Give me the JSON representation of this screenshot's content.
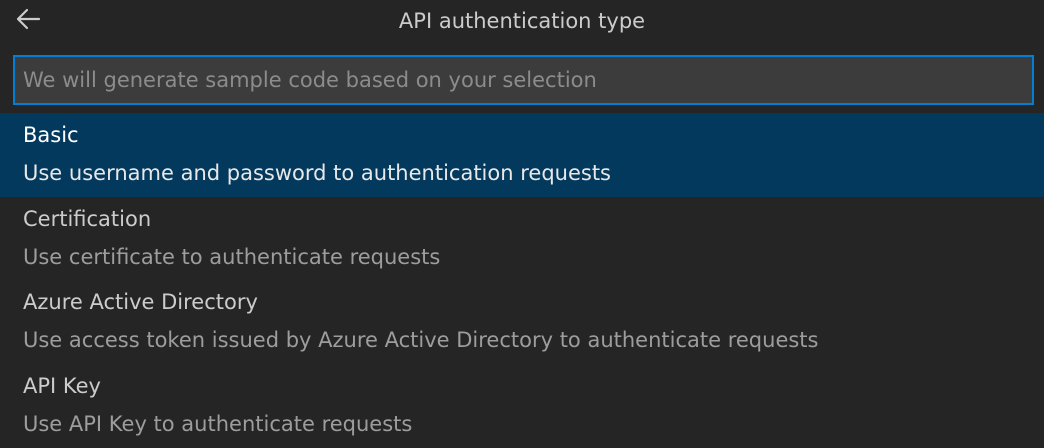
{
  "header": {
    "title": "API authentication type",
    "back_icon": "arrow-left-icon"
  },
  "input": {
    "placeholder": "We will generate sample code based on your selection",
    "value": ""
  },
  "options": [
    {
      "label": "Basic",
      "description": "Use username and password to authentication requests",
      "selected": true
    },
    {
      "label": "Certification",
      "description": "Use certificate to authenticate requests",
      "selected": false
    },
    {
      "label": "Azure Active Directory",
      "description": "Use access token issued by Azure Active Directory to authenticate requests",
      "selected": false
    },
    {
      "label": "API Key",
      "description": "Use API Key to authenticate requests",
      "selected": false
    }
  ],
  "colors": {
    "background": "#252526",
    "input_background": "#3c3c3c",
    "focus_border": "#007fd4",
    "selected_background": "#04395e"
  }
}
